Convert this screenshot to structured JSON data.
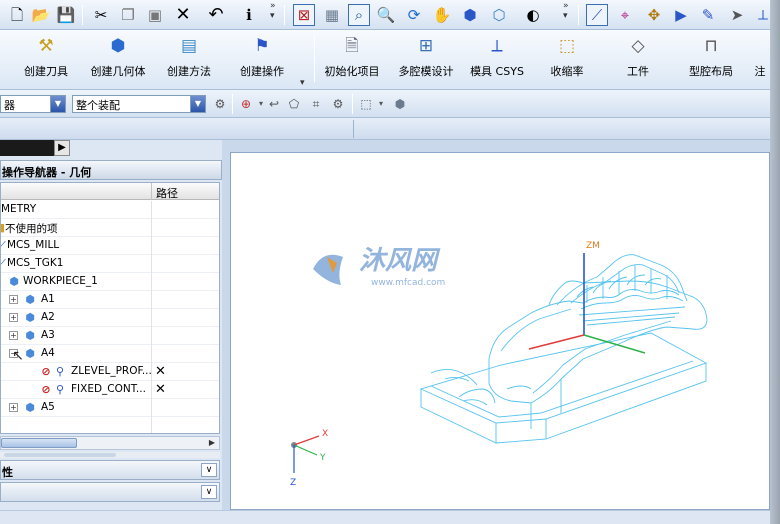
{
  "toolbar_top": {
    "icons": [
      "new-file-icon",
      "open-folder-icon",
      "save-icon",
      "cut-icon",
      "copy-icon",
      "paste-icon",
      "delete-icon",
      "undo-icon",
      "info-icon",
      "fit-view-icon",
      "zoom-window-icon",
      "zoom-icon",
      "zoom-in-icon",
      "rotate-icon",
      "pan-icon",
      "shaded-view-icon",
      "wireframe-view-icon",
      "render-style-icon",
      "wcs-icon",
      "display-icon",
      "move-icon",
      "play-icon",
      "edit-icon",
      "select-icon"
    ]
  },
  "toolbar_main": {
    "buttons": [
      {
        "label": "创建刀具"
      },
      {
        "label": "创建几何体"
      },
      {
        "label": "创建方法"
      },
      {
        "label": "创建操作"
      },
      {
        "label": "初始化项目"
      },
      {
        "label": "多腔模设计"
      },
      {
        "label": "模具 CSYS"
      },
      {
        "label": "收缩率"
      },
      {
        "label": "工件"
      },
      {
        "label": "型腔布局"
      },
      {
        "label": "注"
      }
    ]
  },
  "selection_bar": {
    "filter_value": "器",
    "scope_value": "整个装配"
  },
  "navigator": {
    "title": "操作导航器 - 几何",
    "column_path": "路径",
    "rows": [
      {
        "label": "METRY"
      },
      {
        "label": "不使用的项"
      },
      {
        "label": "MCS_MILL"
      },
      {
        "label": "MCS_TGK1"
      },
      {
        "label": "WORKPIECE_1"
      },
      {
        "label": "A1"
      },
      {
        "label": "A2"
      },
      {
        "label": "A3"
      },
      {
        "label": "A4"
      },
      {
        "label": "ZLEVEL_PROF..."
      },
      {
        "label": "FIXED_CONT..."
      },
      {
        "label": "A5"
      }
    ],
    "section1": "性",
    "section2": ""
  },
  "viewport": {
    "watermark_title": "沐风网",
    "watermark_url": "www.mfcad.com",
    "axis_zm": "ZM",
    "axis_x": "X",
    "axis_y": "Y",
    "axis_z": "Z"
  },
  "colors": {
    "wire": "#55c3ee",
    "axis_x": "#e23b3b",
    "axis_y": "#2bb24a",
    "axis_z": "#2456d6",
    "zm_label": "#e07a1a"
  }
}
